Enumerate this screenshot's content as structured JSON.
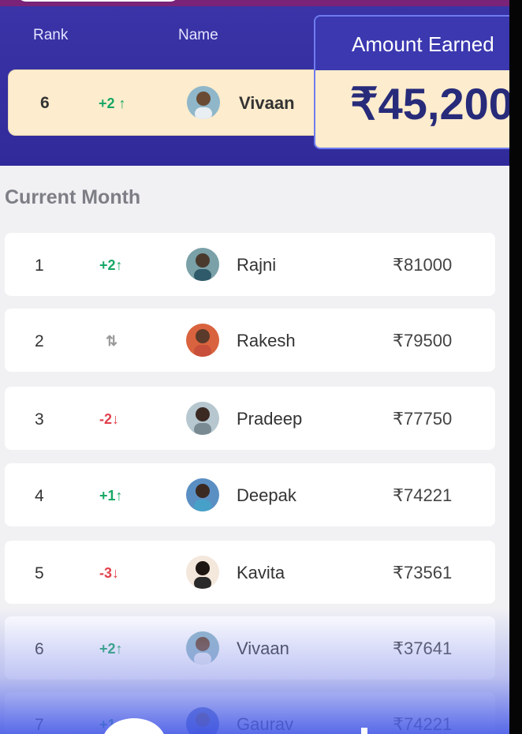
{
  "header": {
    "rank_label": "Rank",
    "name_label": "Name",
    "my_entry": {
      "rank": "6",
      "change": "+2",
      "direction": "up",
      "name": "Vivaan"
    }
  },
  "earned": {
    "label": "Amount Earned",
    "value": "₹45,200"
  },
  "section_title": "Current Month",
  "rows": [
    {
      "rank": "1",
      "change": "+2",
      "direction": "up",
      "name": "Rajni",
      "amount": "₹81000"
    },
    {
      "rank": "2",
      "change": "",
      "direction": "same",
      "name": "Rakesh",
      "amount": "₹79500"
    },
    {
      "rank": "3",
      "change": "-2",
      "direction": "down",
      "name": "Pradeep",
      "amount": "₹77750"
    },
    {
      "rank": "4",
      "change": "+1",
      "direction": "up",
      "name": "Deepak",
      "amount": "₹74221"
    },
    {
      "rank": "5",
      "change": "-3",
      "direction": "down",
      "name": "Kavita",
      "amount": "₹73561"
    },
    {
      "rank": "6",
      "change": "+2",
      "direction": "up",
      "name": "Vivaan",
      "amount": "₹37641"
    },
    {
      "rank": "7",
      "change": "+1",
      "direction": "up",
      "name": "Gaurav",
      "amount": "₹74221"
    }
  ],
  "icons": {
    "up": "arrow-up-icon",
    "down": "arrow-down-icon",
    "same": "swap-vertical-icon"
  },
  "colors": {
    "header_bg": "#3a34a8",
    "highlight_bg": "#fdeccd",
    "up": "#18a765",
    "down": "#e0424d",
    "earned_value": "#272b7a"
  }
}
